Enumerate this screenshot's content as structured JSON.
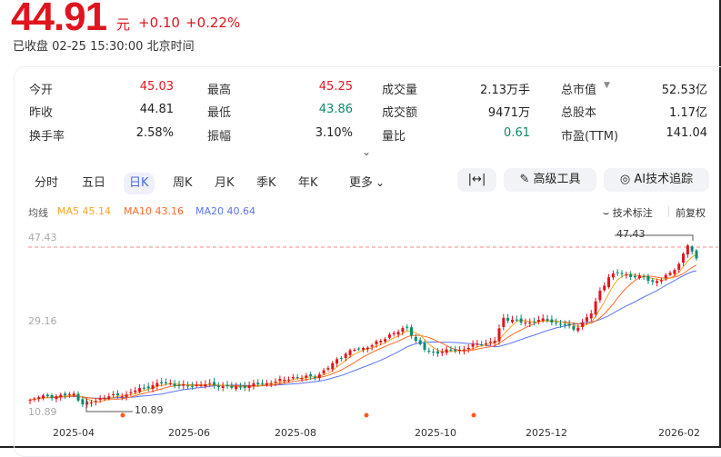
{
  "quote": {
    "price": "44.91",
    "unit": "元",
    "change": "+0.10",
    "change_pct": "+0.22%",
    "status": "已收盘",
    "time": "02-25 15:30:00",
    "tz": "北京时间"
  },
  "stats": [
    [
      {
        "label": "今开",
        "value": "45.03",
        "color": "red"
      },
      {
        "label": "最高",
        "value": "45.25",
        "color": "red"
      },
      {
        "label": "成交量",
        "value": "2.13万手"
      },
      {
        "label": "总市值",
        "value": "52.53亿"
      }
    ],
    [
      {
        "label": "昨收",
        "value": "44.81"
      },
      {
        "label": "最低",
        "value": "43.86",
        "color": "green"
      },
      {
        "label": "成交额",
        "value": "9471万"
      },
      {
        "label": "总股本",
        "value": "1.17亿"
      }
    ],
    [
      {
        "label": "换手率",
        "value": "2.58%"
      },
      {
        "label": "振幅",
        "value": "3.10%"
      },
      {
        "label": "量比",
        "value": "0.61",
        "color": "green"
      },
      {
        "label": "市盈(TTM)",
        "value": "141.04"
      }
    ]
  ],
  "tabs": [
    "分时",
    "五日",
    "日K",
    "周K",
    "月K",
    "季K",
    "年K",
    "更多"
  ],
  "active_tab": "日K",
  "tools": {
    "fit": "|↔|",
    "advanced": "高级工具",
    "ai": "AI技术追踪"
  },
  "ma_legend": {
    "label": "均线",
    "ma5": "MA5 45.14",
    "ma10": "MA10 43.16",
    "ma20": "MA20 40.64"
  },
  "chart_opts": {
    "annotate": "技术标注",
    "adjust": "前复权"
  },
  "colors": {
    "up": "#e0141e",
    "down": "#0b8a6f",
    "ma5": "#f5a623",
    "ma10": "#ff6a2b",
    "ma20": "#5b74f0"
  },
  "chart_data": {
    "type": "candlestick",
    "ylim": [
      10.89,
      47.43
    ],
    "yticks": [
      "47.43",
      "29.16",
      "10.89"
    ],
    "max_label": "47.43",
    "min_label": "10.89",
    "xticks": [
      "2025-04",
      "2025-06",
      "2025-08",
      "2025-10",
      "2025-12",
      "2026-02"
    ],
    "closes": [
      13.3,
      13.9,
      14.1,
      14.1,
      14.3,
      14.7,
      12.3,
      12.7,
      13.7,
      14.1,
      14.3,
      14.5,
      15.4,
      16,
      16.6,
      17,
      17,
      16.4,
      16.4,
      16.6,
      16.8,
      16.6,
      16.4,
      16,
      16.2,
      16.6,
      16.8,
      17,
      17.4,
      17.8,
      18.4,
      18.2,
      18.6,
      19,
      20.4,
      22.4,
      23.6,
      24.5,
      24.9,
      25.5,
      26.5,
      27.9,
      28.5,
      29.6,
      26.5,
      24.5,
      23.9,
      24.1,
      24.3,
      24.5,
      24.9,
      25.9,
      25.9,
      26.5,
      31.6,
      31.2,
      30.6,
      30.6,
      31.2,
      31,
      30.6,
      30,
      29,
      30.6,
      32.6,
      37.7,
      40.7,
      41.7,
      41.3,
      40.7,
      40.7,
      39.7,
      40.1,
      41.7,
      43.7,
      47.8,
      44.91
    ],
    "last": 44.91
  }
}
